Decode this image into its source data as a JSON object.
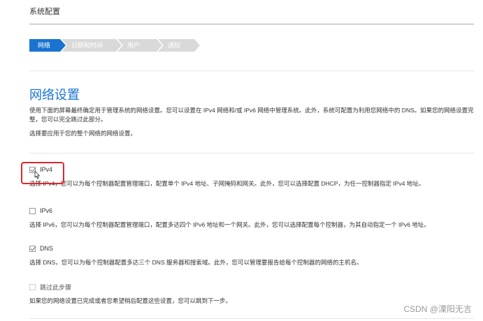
{
  "header": {
    "title": "系统配置"
  },
  "steps": [
    {
      "label": "网络",
      "active": true
    },
    {
      "label": "日期和时间",
      "active": false
    },
    {
      "label": "用户",
      "active": false
    },
    {
      "label": "通知",
      "active": false
    }
  ],
  "main": {
    "heading": "网络设置",
    "description": "使用下面的屏幕最终确定用于管理系统的网络设置。您可以设置在 IPv4 网络和/或 IPv6 网络中管理系统。此外，系统可配置为利用您网络中的 DNS。如果您的网络设置完整，您可以完全跳过此部分。",
    "choose_prompt": "选择要应用于您的整个网络的网络设置。"
  },
  "options": [
    {
      "label": "IPv4",
      "checked": true,
      "description": "选择 IPv4，您可以为每个控制器配置管理端口，配置单个 IPv4 地址、子网掩码和网关。此外，您可以选择配置 DHCP，为任一控制器指定 IPv4 地址。"
    },
    {
      "label": "IPv6",
      "checked": false,
      "description": "选择 IPv6，您可以为每个控制器配置管理端口，配置多达四个 IPv6 地址和一个网关。此外，您可以选择配置每个控制器，为其自动指定一个 IPv6 地址。"
    },
    {
      "label": "DNS",
      "checked": true,
      "description": "选择 DNS，您可以为每个控制器配置多达三个 DNS 服务器和搜索域。此外，您可以管理要报告给每个控制器的网络的主机名。"
    },
    {
      "label": "跳过此步骤",
      "checked": false,
      "description": "如果您的网络设置已完成或者您希望稍后配置这些设置，您可以跳到下一步。"
    }
  ],
  "watermark": "CSDN @溧阳无言",
  "colors": {
    "accent": "#1a73d0",
    "inactive_step": "#d9d9d9",
    "highlight": "#e0262e"
  }
}
